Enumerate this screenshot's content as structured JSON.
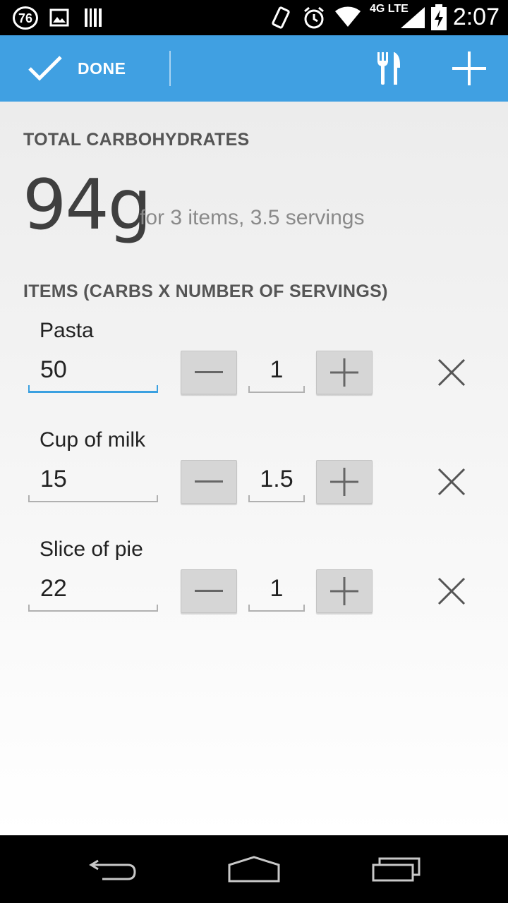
{
  "status_bar": {
    "notification_badge": "76",
    "time": "2:07",
    "network": "4G LTE",
    "icons": [
      "image-icon",
      "barcode-icon",
      "vibrate-icon",
      "alarm-icon",
      "wifi-icon",
      "signal-icon",
      "battery-charging-icon"
    ]
  },
  "action_bar": {
    "done_label": "DONE",
    "background_color": "#40a0e2",
    "icons": [
      "check-icon",
      "fork-knife-icon",
      "plus-icon"
    ]
  },
  "summary": {
    "header": "TOTAL CARBOHYDRATES",
    "total": "94g",
    "detail": "for 3 items, 3.5 servings"
  },
  "items_section": {
    "header": "ITEMS (CARBS X NUMBER OF SERVINGS)",
    "items": [
      {
        "name": "Pasta",
        "carbs": "50",
        "servings": "1",
        "focused": true
      },
      {
        "name": "Cup of milk",
        "carbs": "15",
        "servings": "1.5",
        "focused": false
      },
      {
        "name": "Slice of pie",
        "carbs": "22",
        "servings": "1",
        "focused": false
      }
    ]
  },
  "nav_bar": {
    "icons": [
      "back-icon",
      "home-icon",
      "recent-apps-icon"
    ]
  },
  "colors": {
    "accent": "#40a0e2",
    "focus_underline": "#3aa0e0"
  }
}
